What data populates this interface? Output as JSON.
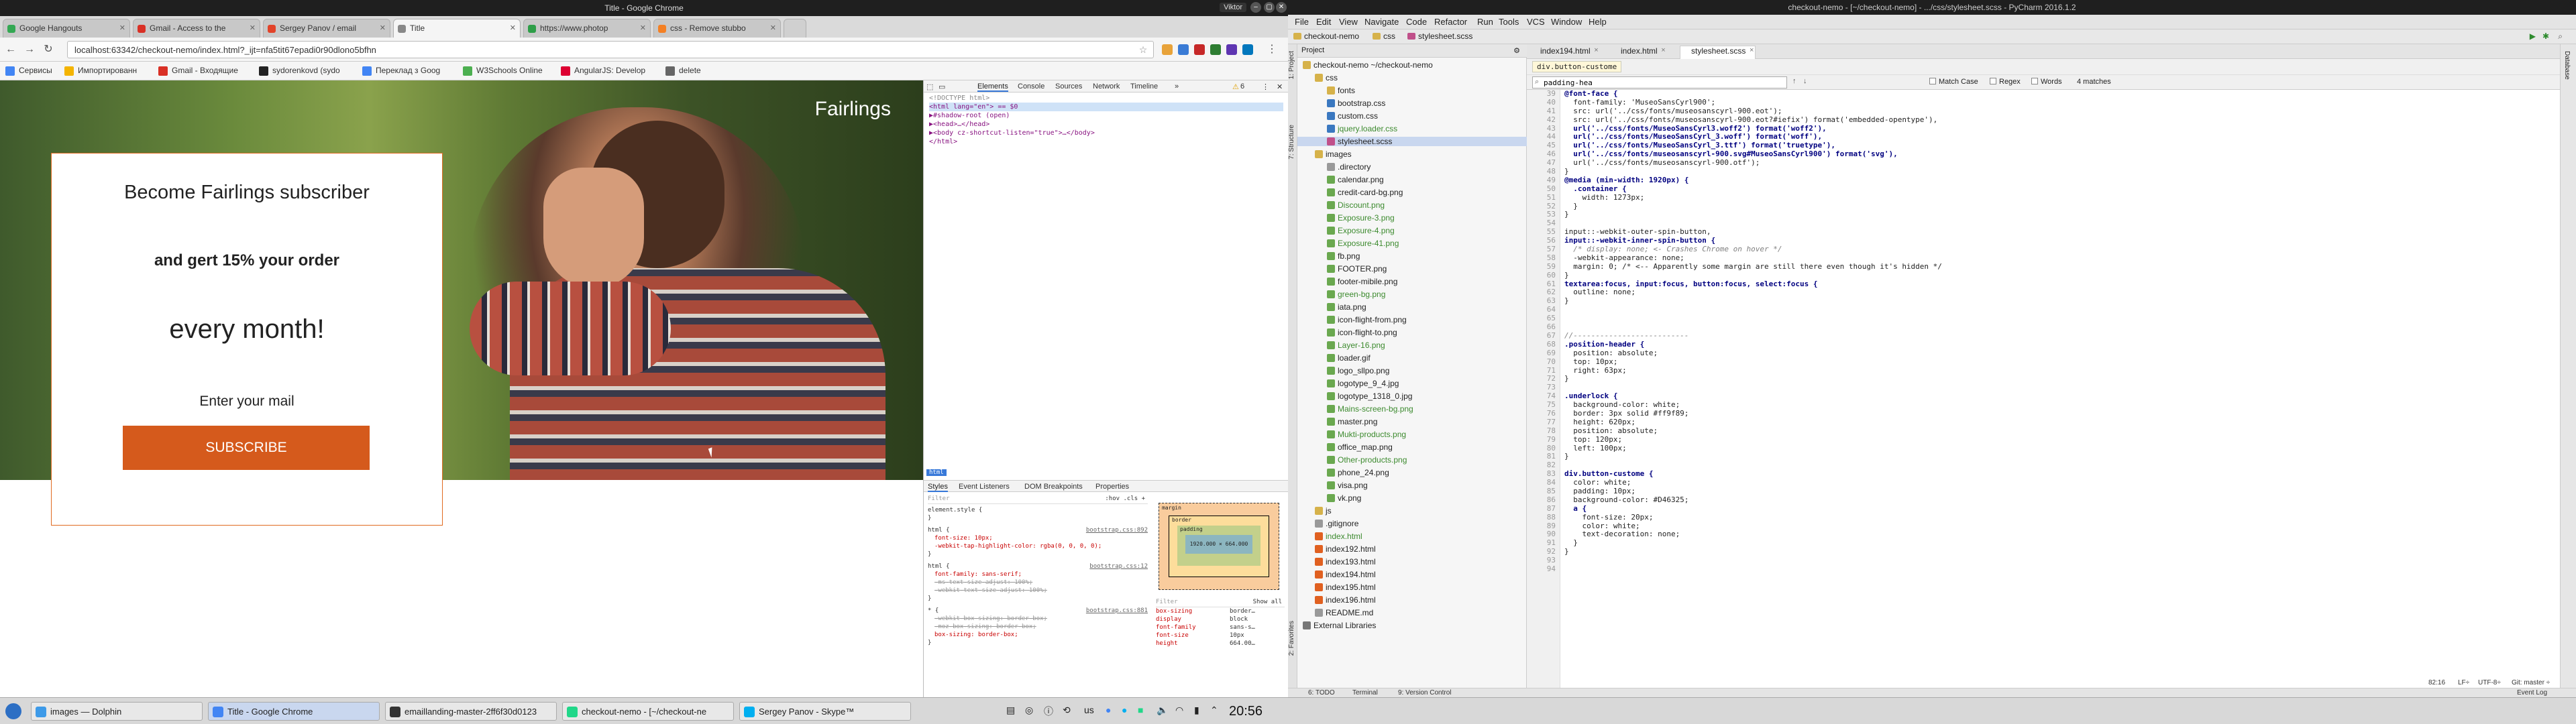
{
  "chrome": {
    "window_title": "Title - Google Chrome",
    "user_badge": "Viktor",
    "tabs": [
      {
        "label": "Google Hangouts",
        "color": "#34a853"
      },
      {
        "label": "Gmail - Access to the",
        "color": "#d93025"
      },
      {
        "label": "Sergey Panov / email",
        "color": "#e24329"
      },
      {
        "label": "Title",
        "color": "#888888"
      },
      {
        "label": "https://www.photop",
        "color": "#2e9e48"
      },
      {
        "label": "css - Remove stubbo",
        "color": "#f48024"
      }
    ],
    "url": "localhost:63342/checkout-nemo/index.html?_ijt=nfa5tit67epadi0r90dlono5bfhn",
    "bookmarks": [
      {
        "label": "Сервисы",
        "color": "#4285f4"
      },
      {
        "label": "Импортированн",
        "color": "#f4b400"
      },
      {
        "label": "Gmail - Входящие",
        "color": "#d93025"
      },
      {
        "label": "sydorenkovd (sydo",
        "color": "#222222"
      },
      {
        "label": "Переклад з Goog",
        "color": "#4285f4"
      },
      {
        "label": "W3Schools Online",
        "color": "#4caf50"
      },
      {
        "label": "AngularJS: Develop",
        "color": "#dd0031"
      },
      {
        "label": "delete",
        "color": "#666666"
      }
    ]
  },
  "page": {
    "brand": "Fairlings",
    "card_title": "Become Fairlings subscriber",
    "card_offer": "and gert 15% your order",
    "card_period": "every month!",
    "mail_label": "Enter your mail",
    "subscribe_label": "SUBSCRIBE",
    "accent_color": "#d55a1c"
  },
  "devtools": {
    "tabs": [
      "Elements",
      "Console",
      "Sources",
      "Network",
      "Timeline"
    ],
    "warn_count": "6",
    "dom_lines": [
      "<!DOCTYPE html>",
      "<html lang=\"en\"> == $0",
      "  ▶#shadow-root (open)",
      "  ▶<head>…</head>",
      "  ▶<body cz-shortcut-listen=\"true\">…</body>",
      "</html>"
    ],
    "selected_chip": "html",
    "bottom_tabs": [
      "Styles",
      "Event Listeners",
      "DOM Breakpoints",
      "Properties"
    ],
    "filter_placeholder": "Filter",
    "filter_flags": ":hov  .cls  +",
    "style_rules": [
      {
        "sel": "element.style {",
        "src": "",
        "props": [],
        "end": "}"
      },
      {
        "sel": "html {",
        "src": "bootstrap.css:892",
        "props": [
          {
            "t": "font-size: 10px;",
            "s": false
          },
          {
            "t": "-webkit-tap-highlight-color: rgba(0, 0, 0, 0);",
            "s": false
          }
        ],
        "end": "}"
      },
      {
        "sel": "html {",
        "src": "bootstrap.css:12",
        "props": [
          {
            "t": "font-family: sans-serif;",
            "s": false
          },
          {
            "t": "-ms-text-size-adjust: 100%;",
            "s": true
          },
          {
            "t": "-webkit-text-size-adjust: 100%;",
            "s": true
          }
        ],
        "end": "}"
      },
      {
        "sel": "* {",
        "src": "bootstrap.css:881",
        "props": [
          {
            "t": "-webkit-box-sizing: border-box;",
            "s": true
          },
          {
            "t": "-moz-box-sizing: border-box;",
            "s": true
          },
          {
            "t": "box-sizing: border-box;",
            "s": false
          }
        ],
        "end": "}"
      }
    ],
    "box_labels": {
      "margin": "margin",
      "border": "border",
      "padding": "padding",
      "content": "1920.000 × 664.000"
    },
    "computed_filter": "Filter",
    "show_all": "Show all",
    "computed": [
      {
        "k": "box-sizing",
        "v": "border…"
      },
      {
        "k": "display",
        "v": "block"
      },
      {
        "k": "font-family",
        "v": "sans-s…"
      },
      {
        "k": "font-size",
        "v": "10px"
      },
      {
        "k": "height",
        "v": "664.00…"
      }
    ]
  },
  "pycharm": {
    "window_title": "checkout-nemo - [~/checkout-nemo] - .../css/stylesheet.scss - PyCharm 2016.1.2",
    "menu": [
      "File",
      "Edit",
      "View",
      "Navigate",
      "Code",
      "Refactor",
      "Run",
      "Tools",
      "VCS",
      "Window",
      "Help"
    ],
    "breadcrumbs": [
      "checkout-nemo",
      "css",
      "stylesheet.scss"
    ],
    "left_tabs": [
      "1: Project",
      "7: Structure",
      "2: Favorites"
    ],
    "project_header": "Project",
    "tree": [
      {
        "label": "checkout-nemo ~/checkout-nemo",
        "indent": 0,
        "kind": "folder",
        "green": false,
        "sel": false
      },
      {
        "label": "css",
        "indent": 1,
        "kind": "folder",
        "green": false,
        "sel": false
      },
      {
        "label": "fonts",
        "indent": 2,
        "kind": "folder",
        "green": false,
        "sel": false
      },
      {
        "label": "bootstrap.css",
        "indent": 2,
        "kind": "css",
        "green": false,
        "sel": false
      },
      {
        "label": "custom.css",
        "indent": 2,
        "kind": "css",
        "green": false,
        "sel": false
      },
      {
        "label": "jquery.loader.css",
        "indent": 2,
        "kind": "css",
        "green": true,
        "sel": false
      },
      {
        "label": "stylesheet.scss",
        "indent": 2,
        "kind": "scss",
        "green": false,
        "sel": true
      },
      {
        "label": "images",
        "indent": 1,
        "kind": "folder",
        "green": false,
        "sel": false
      },
      {
        "label": ".directory",
        "indent": 2,
        "kind": "file",
        "green": false,
        "sel": false
      },
      {
        "label": "calendar.png",
        "indent": 2,
        "kind": "img",
        "green": false,
        "sel": false
      },
      {
        "label": "credit-card-bg.png",
        "indent": 2,
        "kind": "img",
        "green": false,
        "sel": false
      },
      {
        "label": "Discount.png",
        "indent": 2,
        "kind": "img",
        "green": true,
        "sel": false
      },
      {
        "label": "Exposure-3.png",
        "indent": 2,
        "kind": "img",
        "green": true,
        "sel": false
      },
      {
        "label": "Exposure-4.png",
        "indent": 2,
        "kind": "img",
        "green": true,
        "sel": false
      },
      {
        "label": "Exposure-41.png",
        "indent": 2,
        "kind": "img",
        "green": true,
        "sel": false
      },
      {
        "label": "fb.png",
        "indent": 2,
        "kind": "img",
        "green": false,
        "sel": false
      },
      {
        "label": "FOOTER.png",
        "indent": 2,
        "kind": "img",
        "green": false,
        "sel": false
      },
      {
        "label": "footer-mibile.png",
        "indent": 2,
        "kind": "img",
        "green": false,
        "sel": false
      },
      {
        "label": "green-bg.png",
        "indent": 2,
        "kind": "img",
        "green": true,
        "sel": false
      },
      {
        "label": "iata.png",
        "indent": 2,
        "kind": "img",
        "green": false,
        "sel": false
      },
      {
        "label": "icon-flight-from.png",
        "indent": 2,
        "kind": "img",
        "green": false,
        "sel": false
      },
      {
        "label": "icon-flight-to.png",
        "indent": 2,
        "kind": "img",
        "green": false,
        "sel": false
      },
      {
        "label": "Layer-16.png",
        "indent": 2,
        "kind": "img",
        "green": true,
        "sel": false
      },
      {
        "label": "loader.gif",
        "indent": 2,
        "kind": "img",
        "green": false,
        "sel": false
      },
      {
        "label": "logo_sllpo.png",
        "indent": 2,
        "kind": "img",
        "green": false,
        "sel": false
      },
      {
        "label": "logotype_9_4.jpg",
        "indent": 2,
        "kind": "img",
        "green": false,
        "sel": false
      },
      {
        "label": "logotype_1318_0.jpg",
        "indent": 2,
        "kind": "img",
        "green": false,
        "sel": false
      },
      {
        "label": "Mains-screen-bg.png",
        "indent": 2,
        "kind": "img",
        "green": true,
        "sel": false
      },
      {
        "label": "master.png",
        "indent": 2,
        "kind": "img",
        "green": false,
        "sel": false
      },
      {
        "label": "Mukti-products.png",
        "indent": 2,
        "kind": "img",
        "green": true,
        "sel": false
      },
      {
        "label": "office_map.png",
        "indent": 2,
        "kind": "img",
        "green": false,
        "sel": false
      },
      {
        "label": "Other-products.png",
        "indent": 2,
        "kind": "img",
        "green": true,
        "sel": false
      },
      {
        "label": "phone_24.png",
        "indent": 2,
        "kind": "img",
        "green": false,
        "sel": false
      },
      {
        "label": "visa.png",
        "indent": 2,
        "kind": "img",
        "green": false,
        "sel": false
      },
      {
        "label": "vk.png",
        "indent": 2,
        "kind": "img",
        "green": false,
        "sel": false
      },
      {
        "label": "js",
        "indent": 1,
        "kind": "folder",
        "green": false,
        "sel": false
      },
      {
        "label": ".gitignore",
        "indent": 1,
        "kind": "file",
        "green": false,
        "sel": false
      },
      {
        "label": "index.html",
        "indent": 1,
        "kind": "html",
        "green": true,
        "sel": false
      },
      {
        "label": "index192.html",
        "indent": 1,
        "kind": "html",
        "green": false,
        "sel": false
      },
      {
        "label": "index193.html",
        "indent": 1,
        "kind": "html",
        "green": false,
        "sel": false
      },
      {
        "label": "index194.html",
        "indent": 1,
        "kind": "html",
        "green": false,
        "sel": false
      },
      {
        "label": "index195.html",
        "indent": 1,
        "kind": "html",
        "green": false,
        "sel": false
      },
      {
        "label": "index196.html",
        "indent": 1,
        "kind": "html",
        "green": false,
        "sel": false
      },
      {
        "label": "README.md",
        "indent": 1,
        "kind": "file",
        "green": false,
        "sel": false
      },
      {
        "label": "External Libraries",
        "indent": 0,
        "kind": "lib",
        "green": false,
        "sel": false
      }
    ],
    "editor_tabs": [
      "index194.html",
      "index.html",
      "stylesheet.scss"
    ],
    "active_editor_tab": 2,
    "selector_chip": "div.button-custome",
    "find_query": "padding-hea",
    "find_options": [
      "Match Case",
      "Regex",
      "Words"
    ],
    "find_result": "4 matches",
    "first_line": 39,
    "code_lines": [
      "@font-face {",
      "  font-family: 'MuseoSansCyrl900';",
      "  src: url('../css/fonts/museosanscyrl-900.eot');",
      "  src: url('../css/fonts/museosanscyrl-900.eot?#iefix') format('embedded-opentype'),",
      "  url('../css/fonts/MuseoSansCyrl3.woff2') format('woff2'),",
      "  url('../css/fonts/MuseoSansCyrl_3.woff') format('woff'),",
      "  url('../css/fonts/MuseoSansCyrl_3.ttf') format('truetype'),",
      "  url('../css/fonts/museosanscyrl-900.svg#MuseoSansCyrl900') format('svg'),",
      "  url('../css/fonts/museosanscyrl-900.otf');",
      "}",
      "@media (min-width: 1920px) {",
      "  .container {",
      "    width: 1273px;",
      "  }",
      "}",
      "",
      "input::-webkit-outer-spin-button,",
      "input::-webkit-inner-spin-button {",
      "  /* display: none; <- Crashes Chrome on hover */",
      "  -webkit-appearance: none;",
      "  margin: 0; /* <-- Apparently some margin are still there even though it's hidden */",
      "}",
      "textarea:focus, input:focus, button:focus, select:focus {",
      "  outline: none;",
      "}",
      "",
      "",
      "",
      "//--------------------------",
      ".position-header {",
      "  position: absolute;",
      "  top: 10px;",
      "  right: 63px;",
      "}",
      "",
      ".underlock {",
      "  background-color: white;",
      "  border: 3px solid #ff9f89;",
      "  height: 620px;",
      "  position: absolute;",
      "  top: 120px;",
      "  left: 100px;",
      "}",
      "",
      "div.button-custome {",
      "  color: white;",
      "  padding: 10px;",
      "  background-color: #D46325;",
      "  a {",
      "    font-size: 20px;",
      "    color: white;",
      "    text-decoration: none;",
      "  }",
      "}",
      "",
      ""
    ],
    "status": {
      "todo": "6: TODO",
      "terminal": "Terminal",
      "vcs": "9: Version Control",
      "event_log": "Event Log",
      "position": "82:16",
      "lf": "LF÷",
      "encoding": "UTF-8÷",
      "git": "Git: master ÷"
    }
  },
  "taskbar": {
    "tasks": [
      {
        "label": "images — Dolphin",
        "color": "#3d9ae8"
      },
      {
        "label": "Title - Google Chrome",
        "color": "#4285f4"
      },
      {
        "label": "emaillanding-master-2ff6f30d0123",
        "color": "#333333"
      },
      {
        "label": "checkout-nemo - [~/checkout-ne",
        "color": "#21d789"
      },
      {
        "label": "Sergey Panov - Skype™",
        "color": "#00aff0"
      }
    ],
    "active_task": 1,
    "keyboard": "us",
    "clock": "20:56"
  }
}
